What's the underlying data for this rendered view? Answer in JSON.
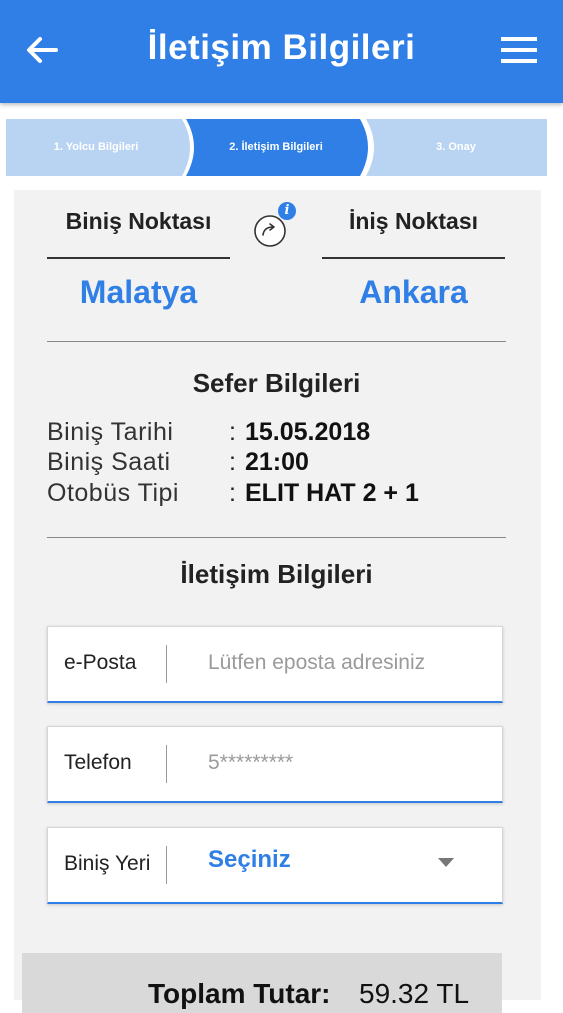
{
  "header": {
    "title": "İletişim Bilgileri",
    "back_icon": "arrow-left-icon",
    "menu_icon": "hamburger-menu-icon",
    "color": "#2f7fe6"
  },
  "steps": [
    {
      "label": "1. Yolcu Bilgileri",
      "state": "done"
    },
    {
      "label": "2. İletişim Bilgileri",
      "state": "active"
    },
    {
      "label": "3. Onay",
      "state": "pending"
    }
  ],
  "route": {
    "departure_label": "Biniş Noktası",
    "arrival_label": "İniş Noktası",
    "departure_city": "Malatya",
    "arrival_city": "Ankara",
    "swap_icon": "swap-arrow-icon",
    "info_icon": "info-icon",
    "info_text": "i"
  },
  "trip": {
    "title": "Sefer Bilgileri",
    "rows": [
      {
        "label": "Biniş Tarihi",
        "sep": ":",
        "value": "15.05.2018"
      },
      {
        "label": "Biniş Saati",
        "sep": ":",
        "value": "21:00"
      },
      {
        "label": "Otobüs Tipi",
        "sep": ":",
        "value": "ELIT HAT 2 + 1"
      }
    ]
  },
  "contact": {
    "title": "İletişim Bilgileri",
    "email": {
      "label": "e-Posta",
      "value": "",
      "placeholder": "Lütfen eposta adresiniz"
    },
    "phone": {
      "label": "Telefon",
      "value": "",
      "placeholder": "5*********"
    },
    "boarding": {
      "label": "Biniş Yeri",
      "selected": "Seçiniz"
    }
  },
  "total": {
    "label": "Toplam Tutar:",
    "value": "59.32 TL"
  },
  "colors": {
    "accent": "#2f7fe6",
    "step_inactive": "#b9d4f3",
    "card_bg": "#f2f2f2"
  }
}
